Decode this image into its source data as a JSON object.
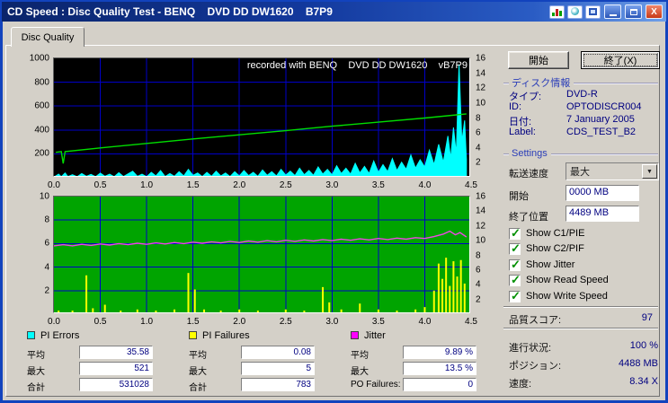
{
  "window": {
    "title": "CD Speed : Disc Quality Test - BENQ    DVD DD DW1620    B7P9",
    "tab": "Disc Quality"
  },
  "buttons": {
    "start": "開始",
    "exit": "終了(X)"
  },
  "disc_info": {
    "header": "ディスク情報",
    "rows": [
      {
        "label": "タイプ:",
        "value": "DVD-R"
      },
      {
        "label": "ID:",
        "value": "OPTODISCR004"
      },
      {
        "label": "日付:",
        "value": "7 January 2005"
      },
      {
        "label": "Label:",
        "value": "CDS_TEST_B2"
      }
    ]
  },
  "settings": {
    "header": "Settings",
    "speed_label": "転送速度",
    "speed_value": "最大",
    "start_label": "開始",
    "start_value": "0000 MB",
    "end_label": "終了位置",
    "end_value": "4489 MB",
    "checkboxes": [
      {
        "label": "Show C1/PIE",
        "checked": true
      },
      {
        "label": "Show C2/PIF",
        "checked": true
      },
      {
        "label": "Show Jitter",
        "checked": true
      },
      {
        "label": "Show Read Speed",
        "checked": true
      },
      {
        "label": "Show Write Speed",
        "checked": true
      }
    ]
  },
  "score": {
    "label": "品質スコア:",
    "value": "97"
  },
  "progress": [
    {
      "label": "進行状況:",
      "value": "100 %"
    },
    {
      "label": "ポジション:",
      "value": "4488 MB"
    },
    {
      "label": "速度:",
      "value": "8.34 X"
    }
  ],
  "stats": [
    {
      "legend": "PI Errors",
      "color": "#00FFFF",
      "rows": [
        {
          "label": "平均",
          "value": "35.58"
        },
        {
          "label": "最大",
          "value": "521"
        },
        {
          "label": "合計",
          "value": "531028"
        }
      ]
    },
    {
      "legend": "PI Failures",
      "color": "#FFFF00",
      "rows": [
        {
          "label": "平均",
          "value": "0.08"
        },
        {
          "label": "最大",
          "value": "5"
        },
        {
          "label": "合計",
          "value": "783"
        }
      ]
    },
    {
      "legend": "Jitter",
      "color": "#FF00FF",
      "rows": [
        {
          "label": "平均",
          "value": "9.89 %"
        },
        {
          "label": "最大",
          "value": "13.5 %"
        },
        {
          "label": "PO Failures:",
          "value": "0"
        }
      ]
    }
  ],
  "chart_data": [
    {
      "type": "line",
      "title": "recorded with BENQ    DVD DD DW1620    vB7P9",
      "bg": "#000000",
      "grid": "#0000C8",
      "xlim": [
        0,
        4.5
      ],
      "xticks": [
        "0.0",
        "0.5",
        "1.0",
        "1.5",
        "2.0",
        "2.5",
        "3.0",
        "3.5",
        "4.0",
        "4.5"
      ],
      "ylim_left": [
        0,
        1000
      ],
      "yticks_left": [
        "1000",
        "800",
        "600",
        "400",
        "200"
      ],
      "ylim_right": [
        0,
        16
      ],
      "yticks_right": [
        "16",
        "14",
        "12",
        "10",
        "8",
        "6",
        "4",
        "2"
      ],
      "series": [
        {
          "name": "pi-errors-raw",
          "color": "#00FFFF",
          "axis": "left",
          "type": "area",
          "points": [
            [
              0.0,
              5
            ],
            [
              0.05,
              30
            ],
            [
              0.08,
              8
            ],
            [
              0.12,
              40
            ],
            [
              0.15,
              10
            ],
            [
              0.2,
              25
            ],
            [
              0.25,
              8
            ],
            [
              0.3,
              35
            ],
            [
              0.35,
              12
            ],
            [
              0.4,
              28
            ],
            [
              0.45,
              8
            ],
            [
              0.5,
              38
            ],
            [
              0.55,
              12
            ],
            [
              0.6,
              30
            ],
            [
              0.65,
              8
            ],
            [
              0.7,
              42
            ],
            [
              0.75,
              10
            ],
            [
              0.8,
              32
            ],
            [
              0.85,
              55
            ],
            [
              0.9,
              12
            ],
            [
              0.95,
              30
            ],
            [
              1.0,
              8
            ],
            [
              1.05,
              45
            ],
            [
              1.1,
              15
            ],
            [
              1.15,
              60
            ],
            [
              1.2,
              10
            ],
            [
              1.25,
              35
            ],
            [
              1.3,
              12
            ],
            [
              1.35,
              50
            ],
            [
              1.4,
              15
            ],
            [
              1.45,
              70
            ],
            [
              1.5,
              20
            ],
            [
              1.55,
              40
            ],
            [
              1.6,
              10
            ],
            [
              1.65,
              45
            ],
            [
              1.7,
              12
            ],
            [
              1.75,
              55
            ],
            [
              1.8,
              15
            ],
            [
              1.85,
              40
            ],
            [
              1.9,
              10
            ],
            [
              1.95,
              50
            ],
            [
              2.0,
              15
            ],
            [
              2.05,
              60
            ],
            [
              2.1,
              18
            ],
            [
              2.15,
              45
            ],
            [
              2.2,
              12
            ],
            [
              2.25,
              65
            ],
            [
              2.3,
              20
            ],
            [
              2.35,
              50
            ],
            [
              2.4,
              15
            ],
            [
              2.45,
              70
            ],
            [
              2.5,
              22
            ],
            [
              2.55,
              55
            ],
            [
              2.6,
              18
            ],
            [
              2.65,
              80
            ],
            [
              2.7,
              25
            ],
            [
              2.75,
              60
            ],
            [
              2.8,
              20
            ],
            [
              2.85,
              90
            ],
            [
              2.9,
              30
            ],
            [
              2.95,
              70
            ],
            [
              3.0,
              25
            ],
            [
              3.05,
              100
            ],
            [
              3.1,
              35
            ],
            [
              3.15,
              80
            ],
            [
              3.2,
              30
            ],
            [
              3.25,
              120
            ],
            [
              3.3,
              40
            ],
            [
              3.35,
              95
            ],
            [
              3.4,
              35
            ],
            [
              3.45,
              140
            ],
            [
              3.5,
              45
            ],
            [
              3.55,
              110
            ],
            [
              3.6,
              50
            ],
            [
              3.65,
              160
            ],
            [
              3.7,
              60
            ],
            [
              3.75,
              130
            ],
            [
              3.8,
              70
            ],
            [
              3.85,
              190
            ],
            [
              3.9,
              80
            ],
            [
              3.95,
              150
            ],
            [
              4.0,
              90
            ],
            [
              4.05,
              230
            ],
            [
              4.1,
              110
            ],
            [
              4.15,
              280
            ],
            [
              4.2,
              130
            ],
            [
              4.25,
              350
            ],
            [
              4.28,
              160
            ],
            [
              4.31,
              420
            ],
            [
              4.34,
              200
            ],
            [
              4.37,
              950
            ],
            [
              4.4,
              300
            ],
            [
              4.43,
              480
            ],
            [
              4.45,
              150
            ]
          ]
        },
        {
          "name": "read-speed",
          "color": "#00DD00",
          "axis": "right",
          "type": "line",
          "points": [
            [
              0.02,
              3.4
            ],
            [
              0.08,
              3.5
            ],
            [
              0.1,
              1.9
            ],
            [
              0.12,
              3.5
            ],
            [
              0.5,
              4.0
            ],
            [
              1.0,
              4.6
            ],
            [
              1.5,
              5.2
            ],
            [
              2.0,
              5.75
            ],
            [
              2.5,
              6.3
            ],
            [
              3.0,
              6.9
            ],
            [
              3.5,
              7.45
            ],
            [
              4.0,
              8.0
            ],
            [
              4.45,
              8.55
            ]
          ]
        }
      ]
    },
    {
      "type": "line",
      "title": "",
      "bg": "#00A400",
      "grid": "#0000C8",
      "xlim": [
        0,
        4.5
      ],
      "xticks": [
        "0.0",
        "0.5",
        "1.0",
        "1.5",
        "2.0",
        "2.5",
        "3.0",
        "3.5",
        "4.0",
        "4.5"
      ],
      "ylim_left": [
        0,
        10
      ],
      "yticks_left": [
        "10",
        "8",
        "6",
        "4",
        "2"
      ],
      "ylim_right": [
        0,
        16
      ],
      "yticks_right": [
        "16",
        "14",
        "12",
        "10",
        "8",
        "6",
        "4",
        "2"
      ],
      "series": [
        {
          "name": "pi-failures",
          "color": "#FFFF00",
          "axis": "left",
          "type": "spikes",
          "points": [
            [
              0.05,
              0.3
            ],
            [
              0.2,
              0.3
            ],
            [
              0.35,
              3.3
            ],
            [
              0.42,
              0.5
            ],
            [
              0.55,
              0.8
            ],
            [
              0.72,
              0.3
            ],
            [
              0.9,
              0.4
            ],
            [
              1.1,
              0.3
            ],
            [
              1.3,
              0.4
            ],
            [
              1.45,
              3.5
            ],
            [
              1.52,
              2.1
            ],
            [
              1.62,
              0.4
            ],
            [
              1.8,
              0.3
            ],
            [
              2.0,
              0.4
            ],
            [
              2.2,
              0.3
            ],
            [
              2.5,
              0.4
            ],
            [
              2.7,
              0.3
            ],
            [
              2.9,
              2.3
            ],
            [
              2.97,
              1.0
            ],
            [
              3.1,
              0.4
            ],
            [
              3.3,
              0.9
            ],
            [
              3.5,
              0.4
            ],
            [
              3.7,
              0.3
            ],
            [
              3.9,
              0.4
            ],
            [
              4.0,
              0.6
            ],
            [
              4.1,
              2.0
            ],
            [
              4.15,
              4.3
            ],
            [
              4.19,
              3.0
            ],
            [
              4.23,
              4.8
            ],
            [
              4.27,
              2.4
            ],
            [
              4.31,
              4.5
            ],
            [
              4.35,
              3.2
            ],
            [
              4.39,
              4.6
            ],
            [
              4.43,
              2.6
            ]
          ]
        },
        {
          "name": "jitter",
          "color": "#F046E6",
          "axis": "right",
          "type": "line",
          "points": [
            [
              0.0,
              9.3
            ],
            [
              0.1,
              9.45
            ],
            [
              0.2,
              9.3
            ],
            [
              0.3,
              9.5
            ],
            [
              0.4,
              9.35
            ],
            [
              0.5,
              9.55
            ],
            [
              0.6,
              9.4
            ],
            [
              0.7,
              9.6
            ],
            [
              0.8,
              9.45
            ],
            [
              0.9,
              9.65
            ],
            [
              1.0,
              9.5
            ],
            [
              1.1,
              9.7
            ],
            [
              1.2,
              9.55
            ],
            [
              1.3,
              9.75
            ],
            [
              1.4,
              9.6
            ],
            [
              1.5,
              9.8
            ],
            [
              1.6,
              9.65
            ],
            [
              1.7,
              9.85
            ],
            [
              1.8,
              9.7
            ],
            [
              1.9,
              9.9
            ],
            [
              2.0,
              9.75
            ],
            [
              2.1,
              9.95
            ],
            [
              2.2,
              9.8
            ],
            [
              2.3,
              10.0
            ],
            [
              2.4,
              9.85
            ],
            [
              2.5,
              10.05
            ],
            [
              2.6,
              9.9
            ],
            [
              2.7,
              10.1
            ],
            [
              2.8,
              9.95
            ],
            [
              2.9,
              10.15
            ],
            [
              3.0,
              10.0
            ],
            [
              3.1,
              10.2
            ],
            [
              3.2,
              10.05
            ],
            [
              3.3,
              10.25
            ],
            [
              3.4,
              10.1
            ],
            [
              3.5,
              10.3
            ],
            [
              3.6,
              10.15
            ],
            [
              3.7,
              10.35
            ],
            [
              3.8,
              10.2
            ],
            [
              3.9,
              10.4
            ],
            [
              4.0,
              10.3
            ],
            [
              4.1,
              10.55
            ],
            [
              4.2,
              10.9
            ],
            [
              4.27,
              11.3
            ],
            [
              4.33,
              10.8
            ],
            [
              4.38,
              11.1
            ],
            [
              4.45,
              10.5
            ]
          ]
        }
      ]
    }
  ]
}
